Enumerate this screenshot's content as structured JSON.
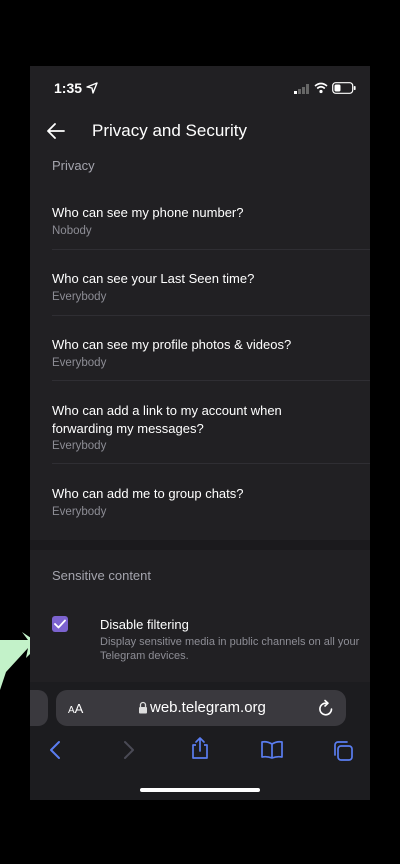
{
  "status_bar": {
    "time": "1:35"
  },
  "header": {
    "title": "Privacy and Security"
  },
  "privacy_section": {
    "heading": "Privacy",
    "items": [
      {
        "question": "Who can see my phone number?",
        "answer": "Nobody"
      },
      {
        "question": "Who can see your Last Seen time?",
        "answer": "Everybody"
      },
      {
        "question": "Who can see my profile photos & videos?",
        "answer": "Everybody"
      },
      {
        "question_line1": "Who can add a link to my account when",
        "question_line2": "forwarding my messages?",
        "answer": "Everybody"
      },
      {
        "question": "Who can add me to group chats?",
        "answer": "Everybody"
      }
    ]
  },
  "sensitive_section": {
    "heading": "Sensitive content",
    "checkbox": {
      "title": "Disable filtering",
      "description": "Display sensitive media in public channels on all your Telegram devices.",
      "checked": true
    }
  },
  "browser": {
    "aa_large": "A",
    "aa_small": "A",
    "url": "web.telegram.org",
    "accent_color": "#5a7df0"
  },
  "colors": {
    "background": "#212023",
    "checkbox": "#7c63cf",
    "pointer_arrow": "#c3f2c9"
  }
}
